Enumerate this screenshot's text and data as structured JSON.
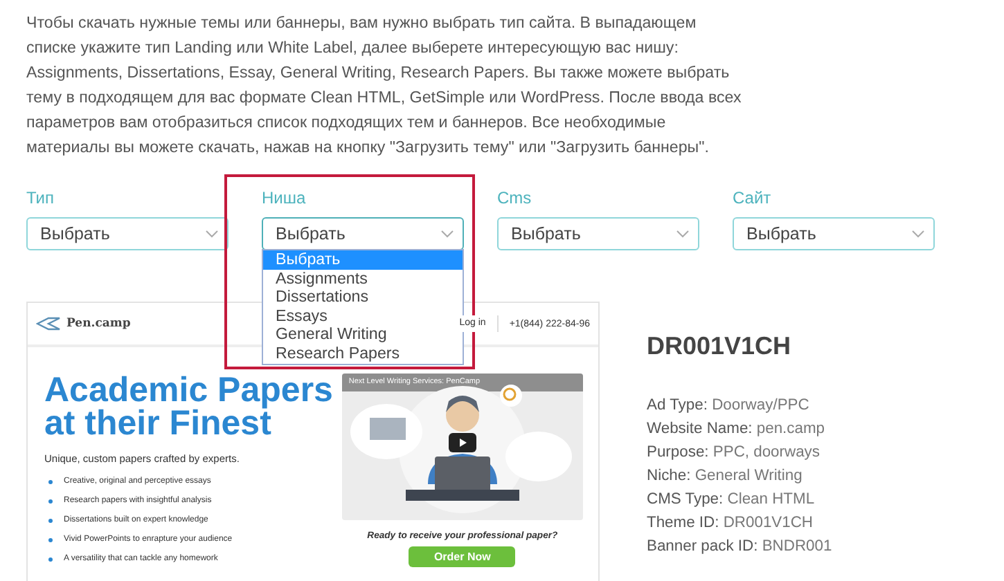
{
  "intro": "Чтобы скачать нужные темы или баннеры, вам нужно выбрать тип сайта. В выпадающем списке укажите тип Landing или White Label, далее выберете интересующую вас нишу: Assignments, Dissertations, Essay, General Writing, Research Papers. Вы также можете выбрать тему в подходящем для вас формате Clean HTML, GetSimple или WordPress. После ввода всех параметров вам отобразиться список подходящих тем и баннеров. Все необходимые материалы вы можете скачать, нажав на кнопку \"Загрузить тему\" или \"Загрузить баннеры\".",
  "filters": [
    {
      "label": "Тип",
      "value": "Выбрать",
      "expanded": false,
      "highlighted": false
    },
    {
      "label": "Ниша",
      "value": "Выбрать",
      "expanded": true,
      "highlighted": true,
      "options": [
        {
          "label": "Выбрать",
          "selected": true
        },
        {
          "label": "Assignments",
          "selected": false
        },
        {
          "label": "Dissertations",
          "selected": false
        },
        {
          "label": "Essays",
          "selected": false
        },
        {
          "label": "General Writing",
          "selected": false
        },
        {
          "label": "Research Papers",
          "selected": false
        }
      ]
    },
    {
      "label": "Cms",
      "value": "Выбрать",
      "expanded": false,
      "highlighted": false
    },
    {
      "label": "Сайт",
      "value": "Выбрать",
      "expanded": false,
      "highlighted": false
    }
  ],
  "preview": {
    "logo": "Pen.camp",
    "login": "Log in",
    "phone": "+1(844) 222-84-96",
    "headline": "Academic Papers at their Finest",
    "subtitle": "Unique, custom papers crafted by experts.",
    "bullets": [
      "Creative, original and perceptive essays",
      "Research papers with insightful analysis",
      "Dissertations built on expert knowledge",
      "Vivid PowerPoints to enrapture your audience",
      "A versatility that can tackle any homework"
    ],
    "video_title": "Next Level Writing Services: PenCamp",
    "cta": "Ready to receive your professional paper?",
    "button": "Order Now"
  },
  "theme": {
    "title": "DR001V1CH",
    "details": [
      {
        "label": "Ad Type:",
        "value": "Doorway/PPC"
      },
      {
        "label": "Website Name:",
        "value": "pen.camp"
      },
      {
        "label": "Purpose:",
        "value": "PPC, doorways"
      },
      {
        "label": "Niche:",
        "value": "General Writing"
      },
      {
        "label": "CMS Type:",
        "value": "Clean HTML"
      },
      {
        "label": "Theme ID:",
        "value": "DR001V1CH"
      },
      {
        "label": "Banner pack ID:",
        "value": "BNDR001"
      }
    ]
  }
}
